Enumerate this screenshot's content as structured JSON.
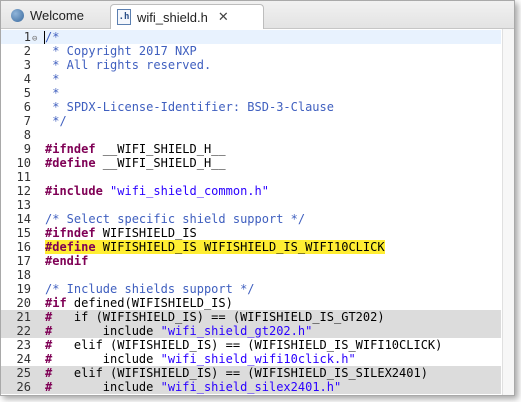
{
  "tabs": {
    "welcome_label": "Welcome",
    "active_label": "wifi_shield.h",
    "close_glyph": "✕",
    "file_icon_text": ".h"
  },
  "lines": [
    {
      "n": "1",
      "segs": [
        {
          "t": "/*",
          "c": "cm"
        }
      ]
    },
    {
      "n": "2",
      "segs": [
        {
          "t": " * Copyright 2017 NXP",
          "c": "cm"
        }
      ]
    },
    {
      "n": "3",
      "segs": [
        {
          "t": " * All rights reserved.",
          "c": "cm"
        }
      ]
    },
    {
      "n": "4",
      "segs": [
        {
          "t": " *",
          "c": "cm"
        }
      ]
    },
    {
      "n": "5",
      "segs": [
        {
          "t": " *",
          "c": "cm"
        }
      ]
    },
    {
      "n": "6",
      "segs": [
        {
          "t": " * SPDX-License-Identifier: BSD-3-Clause",
          "c": "cm"
        }
      ]
    },
    {
      "n": "7",
      "segs": [
        {
          "t": " */",
          "c": "cm"
        }
      ]
    },
    {
      "n": "8",
      "segs": []
    },
    {
      "n": "9",
      "segs": [
        {
          "t": "#ifndef",
          "c": "kw"
        },
        {
          "t": " __WIFI_SHIELD_H__",
          "c": ""
        }
      ]
    },
    {
      "n": "10",
      "segs": [
        {
          "t": "#define",
          "c": "kw"
        },
        {
          "t": " __WIFI_SHIELD_H__",
          "c": ""
        }
      ]
    },
    {
      "n": "11",
      "segs": []
    },
    {
      "n": "12",
      "segs": [
        {
          "t": "#include",
          "c": "kw"
        },
        {
          "t": " ",
          "c": ""
        },
        {
          "t": "\"wifi_shield_common.h\"",
          "c": "str"
        }
      ]
    },
    {
      "n": "13",
      "segs": []
    },
    {
      "n": "14",
      "segs": [
        {
          "t": "/* Select specific shield support */",
          "c": "cm"
        }
      ]
    },
    {
      "n": "15",
      "segs": [
        {
          "t": "#ifndef",
          "c": "kw"
        },
        {
          "t": " WIFISHIELD_IS",
          "c": ""
        }
      ]
    },
    {
      "n": "16",
      "segs": [
        {
          "t": "#define",
          "c": "kw hl"
        },
        {
          "t": " WIFISHIELD_IS WIFISHIELD_IS_WIFI10CLICK",
          "c": "hl"
        }
      ]
    },
    {
      "n": "17",
      "segs": [
        {
          "t": "#endif",
          "c": "kw"
        }
      ]
    },
    {
      "n": "18",
      "segs": []
    },
    {
      "n": "19",
      "segs": [
        {
          "t": "/* Include shields support */",
          "c": "cm"
        }
      ]
    },
    {
      "n": "20",
      "segs": [
        {
          "t": "#if",
          "c": "kw"
        },
        {
          "t": " defined(WIFISHIELD_IS)",
          "c": ""
        }
      ]
    },
    {
      "n": "21",
      "bg": "inactive",
      "segs": [
        {
          "t": "#",
          "c": "kw"
        },
        {
          "t": "   if (WIFISHIELD_IS) == (WIFISHIELD_IS_GT202)",
          "c": ""
        }
      ]
    },
    {
      "n": "22",
      "bg": "inactive",
      "segs": [
        {
          "t": "#",
          "c": "kw"
        },
        {
          "t": "       include ",
          "c": ""
        },
        {
          "t": "\"wifi_shield_gt202.h\"",
          "c": "str"
        }
      ]
    },
    {
      "n": "23",
      "segs": [
        {
          "t": "#",
          "c": "kw"
        },
        {
          "t": "   elif (WIFISHIELD_IS) == (WIFISHIELD_IS_WIFI10CLICK)",
          "c": ""
        }
      ]
    },
    {
      "n": "24",
      "segs": [
        {
          "t": "#",
          "c": "kw"
        },
        {
          "t": "       include ",
          "c": ""
        },
        {
          "t": "\"wifi_shield_wifi10click.h\"",
          "c": "str"
        }
      ]
    },
    {
      "n": "25",
      "bg": "inactive",
      "segs": [
        {
          "t": "#",
          "c": "kw"
        },
        {
          "t": "   elif (WIFISHIELD_IS) == (WIFISHIELD_IS_SILEX2401)",
          "c": ""
        }
      ]
    },
    {
      "n": "26",
      "bg": "inactive",
      "segs": [
        {
          "t": "#",
          "c": "kw"
        },
        {
          "t": "       include ",
          "c": ""
        },
        {
          "t": "\"wifi_shield_silex2401.h\"",
          "c": "str"
        }
      ]
    }
  ]
}
